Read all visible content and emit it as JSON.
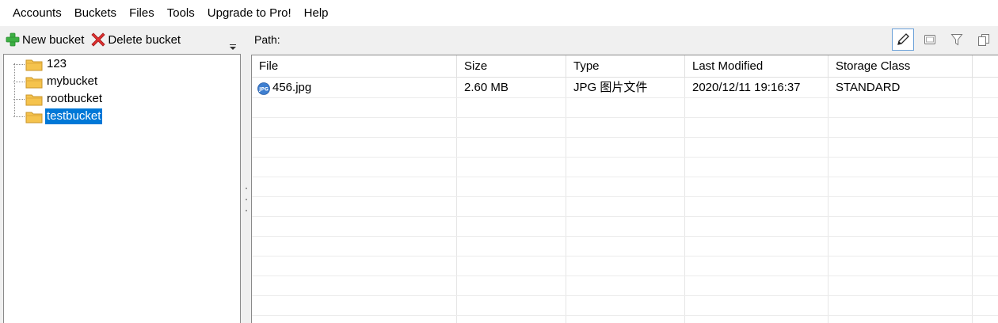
{
  "menu": {
    "items": [
      "Accounts",
      "Buckets",
      "Files",
      "Tools",
      "Upgrade to Pro!",
      "Help"
    ]
  },
  "left_toolbar": {
    "new_bucket": "New bucket",
    "delete_bucket": "Delete bucket"
  },
  "buckets": {
    "items": [
      {
        "label": "123",
        "selected": false
      },
      {
        "label": "mybucket",
        "selected": false
      },
      {
        "label": "rootbucket",
        "selected": false
      },
      {
        "label": "testbucket",
        "selected": true
      }
    ]
  },
  "path_bar": {
    "label": "Path:"
  },
  "file_table": {
    "columns": [
      "File",
      "Size",
      "Type",
      "Last Modified",
      "Storage Class"
    ],
    "rows": [
      {
        "file": "456.jpg",
        "size": "2.60 MB",
        "type": "JPG 图片文件",
        "modified": "2020/12/11 19:16:37",
        "storage_class": "STANDARD",
        "icon": "jpg-file-icon"
      }
    ]
  },
  "colors": {
    "selection": "#0078d7",
    "panel_bg": "#f0f0f0",
    "folder": "#f5c34d",
    "add_icon": "#3cb043",
    "delete_icon": "#e03030"
  }
}
